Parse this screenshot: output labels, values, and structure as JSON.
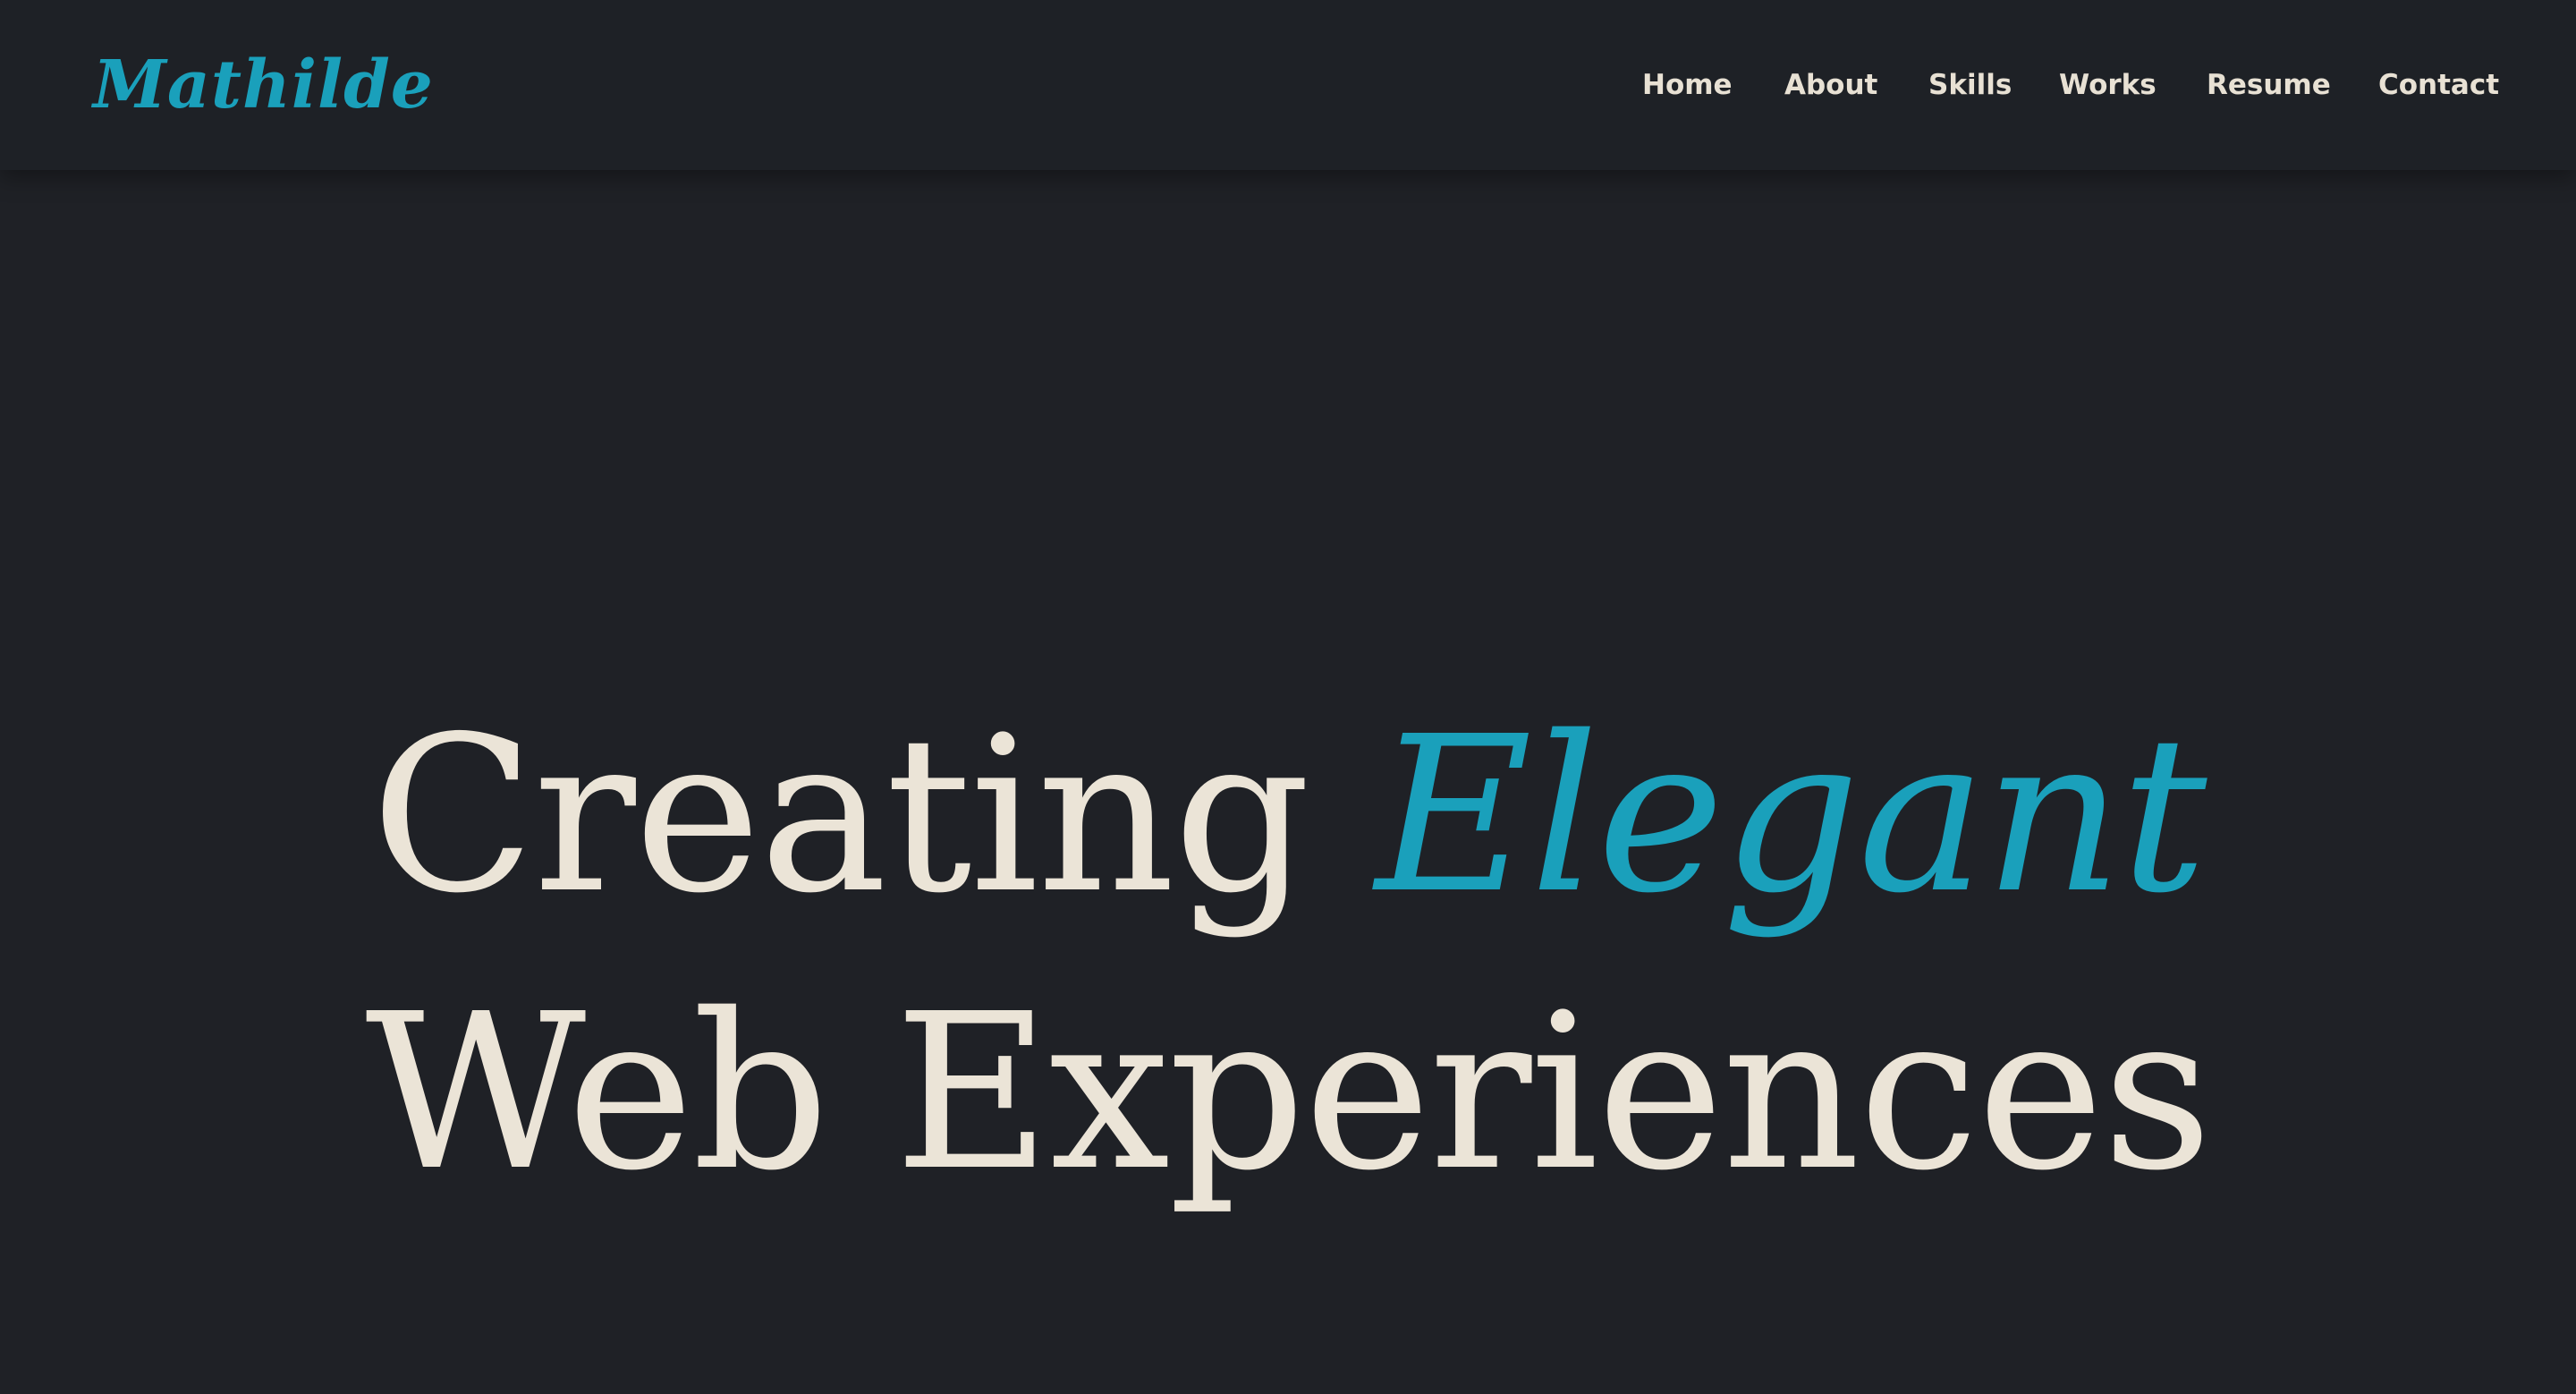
{
  "brand": {
    "name": "Mathilde"
  },
  "nav": {
    "items": [
      {
        "label": "Home"
      },
      {
        "label": "About"
      },
      {
        "label": "Skills"
      },
      {
        "label": "Works"
      },
      {
        "label": "Resume"
      },
      {
        "label": "Contact"
      }
    ]
  },
  "hero": {
    "line1_prefix": "Creating",
    "line1_accent": "Elegant",
    "line2": "Web Experiences"
  },
  "colors": {
    "background": "#1f2126",
    "accent": "#1aa0bb",
    "text": "#ebe4d7"
  }
}
